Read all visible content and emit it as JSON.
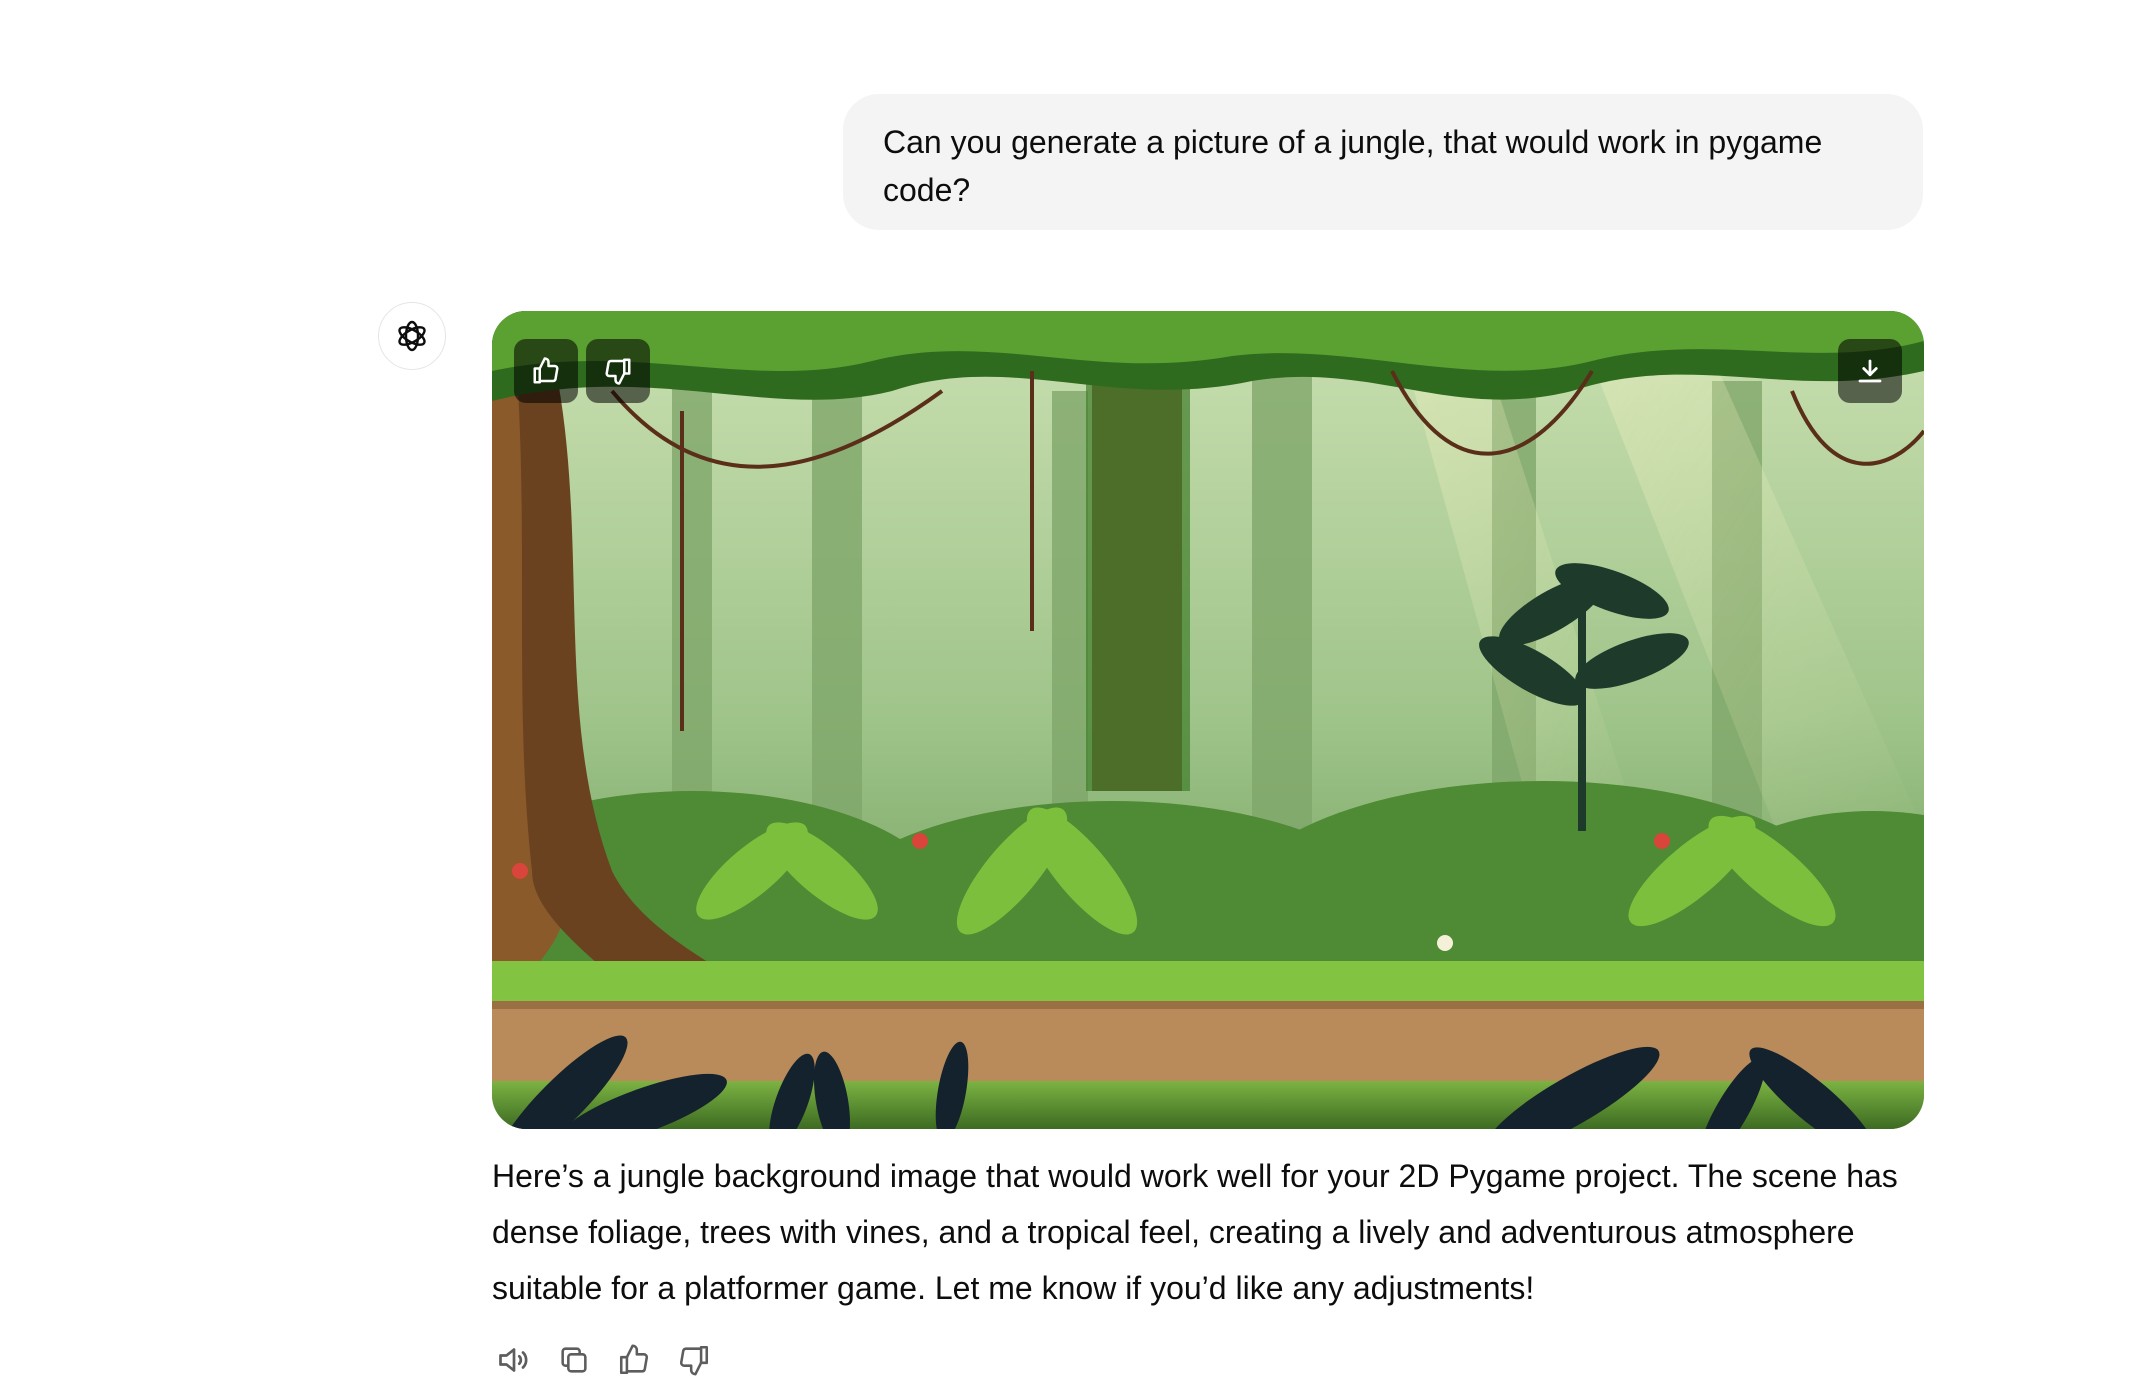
{
  "conversation": {
    "user_message": "Can you generate a picture of a jungle, that would work in pygame code?",
    "assistant_avatar_icon": "openai-logo-icon",
    "assistant_image": {
      "overlay_buttons": [
        "thumbs-up-icon",
        "thumbs-down-icon",
        "download-icon"
      ]
    },
    "assistant_message": "Here’s a jungle background image that would work well for your 2D Pygame project. The scene has dense foliage, trees with vines, and a tropical feel, creating a lively and adventurous atmosphere suitable for a platformer game. Let me know if you’d like any adjustments!",
    "action_icons": [
      "read-aloud-icon",
      "copy-icon",
      "thumbs-up-icon",
      "thumbs-down-icon"
    ]
  }
}
